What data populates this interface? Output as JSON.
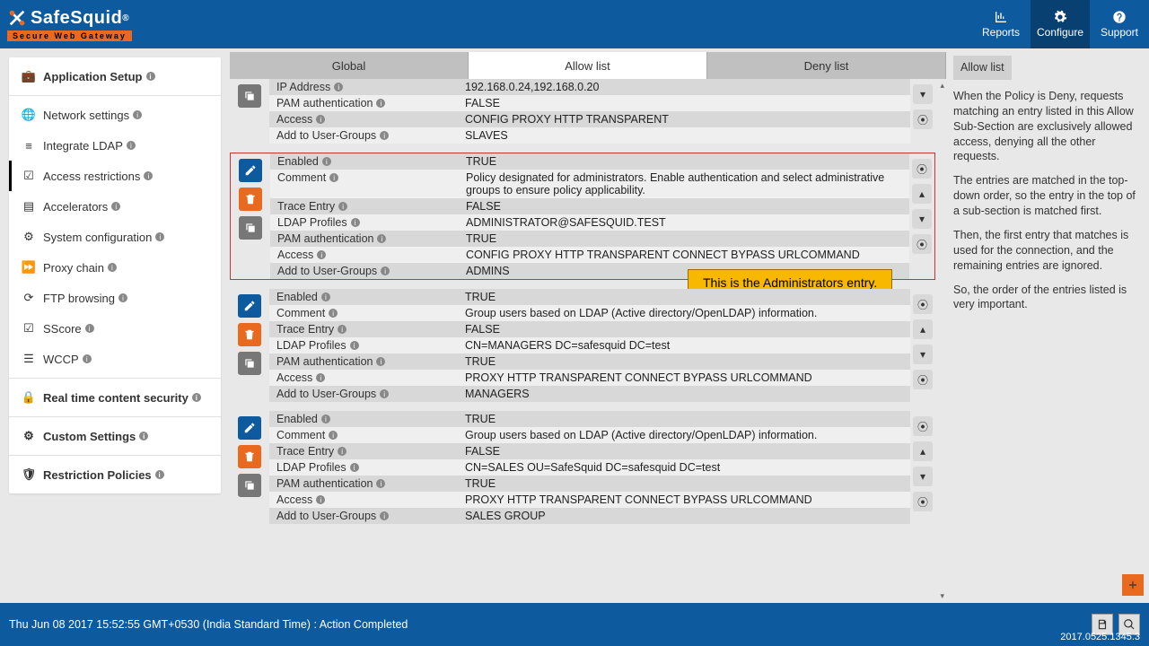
{
  "brand": {
    "name": "SafeSquid",
    "reg": "®",
    "tagline": "Secure Web Gateway"
  },
  "headerNav": {
    "reports": "Reports",
    "configure": "Configure",
    "support": "Support"
  },
  "sidebar": {
    "appSetup": "Application Setup",
    "items": [
      "Network settings",
      "Integrate LDAP",
      "Access restrictions",
      "Accelerators",
      "System configuration",
      "Proxy chain",
      "FTP browsing",
      "SScore",
      "WCCP"
    ],
    "realtime": "Real time content security",
    "custom": "Custom Settings",
    "restriction": "Restriction Policies"
  },
  "tabs": {
    "global": "Global",
    "allow": "Allow list",
    "deny": "Deny list"
  },
  "labels": {
    "enabled": "Enabled",
    "comment": "Comment",
    "trace": "Trace Entry",
    "ip": "IP Address",
    "ldap": "LDAP Profiles",
    "pam": "PAM authentication",
    "access": "Access",
    "add": "Add to User-Groups"
  },
  "callout": "This is the Administrators entry.",
  "entries": [
    {
      "partial": true,
      "rows": {
        "ip": "192.168.0.24,192.168.0.20",
        "pam": "FALSE",
        "access": "CONFIG  PROXY  HTTP  TRANSPARENT",
        "add": "SLAVES"
      }
    },
    {
      "highlight": true,
      "rows": {
        "enabled": "TRUE",
        "comment": "Policy designated for administrators. Enable authentication and select administrative groups to ensure policy applicability.",
        "trace": "FALSE",
        "ldap": "ADMINISTRATOR@SAFESQUID.TEST",
        "pam": "TRUE",
        "access": "CONFIG  PROXY  HTTP  TRANSPARENT  CONNECT  BYPASS  URLCOMMAND",
        "add": "ADMINS"
      }
    },
    {
      "rows": {
        "enabled": "TRUE",
        "comment": "Group users based on LDAP (Active directory/OpenLDAP) information.",
        "trace": "FALSE",
        "ldap": "CN=MANAGERS DC=safesquid DC=test",
        "pam": "TRUE",
        "access": "PROXY  HTTP  TRANSPARENT  CONNECT  BYPASS  URLCOMMAND",
        "add": "MANAGERS"
      }
    },
    {
      "rows": {
        "enabled": "TRUE",
        "comment": "Group users based on LDAP (Active directory/OpenLDAP) information.",
        "trace": "FALSE",
        "ldap": "CN=SALES OU=SafeSquid DC=safesquid DC=test",
        "pam": "TRUE",
        "access": "PROXY  HTTP  TRANSPARENT  CONNECT  BYPASS  URLCOMMAND",
        "add": "SALES GROUP"
      }
    }
  ],
  "right": {
    "title": "Allow list",
    "p1": "When the Policy is Deny, requests matching an entry listed in this Allow Sub-Section are exclusively allowed access, denying all the other requests.",
    "p2": "The entries are matched in the top-down order, so the entry in the top of a sub-section is matched first.",
    "p3": "Then, the first entry that matches is used for the connection, and the remaining entries are ignored.",
    "p4": "So, the order of the entries listed is very important."
  },
  "footer": {
    "status": "Thu Jun 08 2017 15:52:55 GMT+0530 (India Standard Time) : Action Completed",
    "version": "2017.0525.1345.3"
  }
}
